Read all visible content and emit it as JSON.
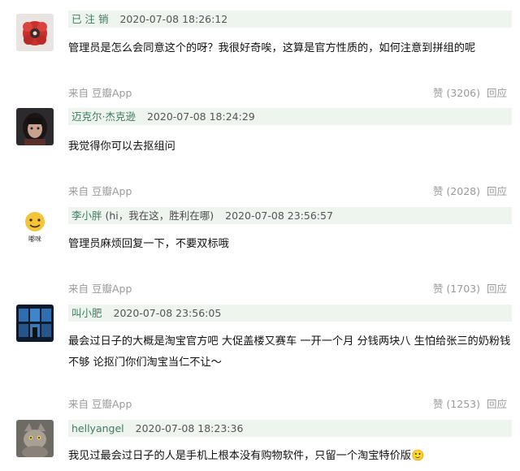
{
  "comments": [
    {
      "username": "已 注 销",
      "extra": "",
      "timestamp": "2020-07-08 18:26:12",
      "text": "管理员是怎么会同意这个的呀？我很好奇唉，这算是官方性质的，如何注意到拼组的呢",
      "source": "来自 豆瓣App",
      "likes": "赞 (3206)",
      "reply": "回应",
      "avatar_icon": "red-pattern-avatar"
    },
    {
      "username": "迈克尔·杰克逊",
      "extra": "",
      "timestamp": "2020-07-08 18:24:29",
      "text": "我觉得你可以去抠组问",
      "source": "来自 豆瓣App",
      "likes": "赞 (2028)",
      "reply": "回应",
      "avatar_icon": "portrait-avatar"
    },
    {
      "username": "李小胖",
      "extra": " (hi，我在这，胜利在哪)",
      "timestamp": "2020-07-08 23:56:57",
      "text": "管理员麻烦回复一下，不要双标哦",
      "source": "来自 豆瓣App",
      "likes": "赞 (1703)",
      "reply": "回应",
      "avatar_icon": "emoji-face-avatar",
      "avatar_caption": "嘟咪"
    },
    {
      "username": "叫小肥",
      "extra": "",
      "timestamp": "2020-07-08 23:56:05",
      "text": "最会过日子的大概是淘宝官方吧 大促盖楼又赛车 一开一个月 分钱两块八 生怕给张三的奶粉钱不够 论抠门你们淘宝当仁不让～",
      "source": "来自 豆瓣App",
      "likes": "赞 (1253)",
      "reply": "回应",
      "avatar_icon": "dark-screens-avatar"
    },
    {
      "username": "hellyangel",
      "extra": "",
      "timestamp": "2020-07-08 18:23:36",
      "text": "我见过最会过日子的人是手机上根本没有购物软件，只留一个淘宝特价版🙂",
      "source": "",
      "likes": "",
      "reply": "",
      "avatar_icon": "cat-avatar"
    }
  ]
}
